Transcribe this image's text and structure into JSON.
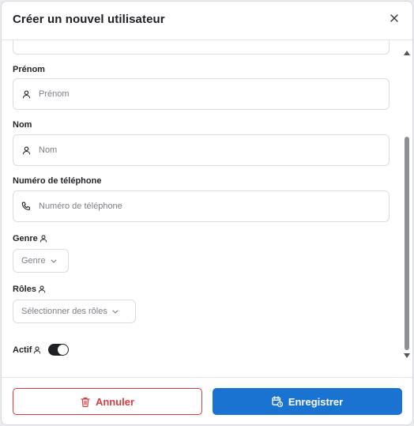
{
  "modal": {
    "title": "Créer un nouvel utilisateur",
    "close_symbol": "×"
  },
  "form": {
    "first_name": {
      "label": "Prénom",
      "placeholder": "Prénom",
      "value": "",
      "icon": "user-icon"
    },
    "last_name": {
      "label": "Nom",
      "placeholder": "Nom",
      "value": "",
      "icon": "user-icon"
    },
    "phone": {
      "label": "Numéro de téléphone",
      "placeholder": "Numéro de téléphone",
      "value": "",
      "icon": "phone-icon"
    },
    "gender": {
      "label": "Genre",
      "selected": "Genre",
      "icon": "user-icon"
    },
    "roles": {
      "label": "Rôles",
      "selected": "Sélectionner des rôles",
      "icon": "user-icon"
    },
    "active": {
      "label": "Actif",
      "checked": true,
      "icon": "user-icon"
    }
  },
  "footer": {
    "cancel_label": "Annuler",
    "cancel_icon": "trash-icon",
    "save_label": "Enregistrer",
    "save_icon": "calendar-icon"
  },
  "colors": {
    "danger": "#d93d3d",
    "primary": "#1a73d1",
    "toggle_on": "#1d2126"
  }
}
